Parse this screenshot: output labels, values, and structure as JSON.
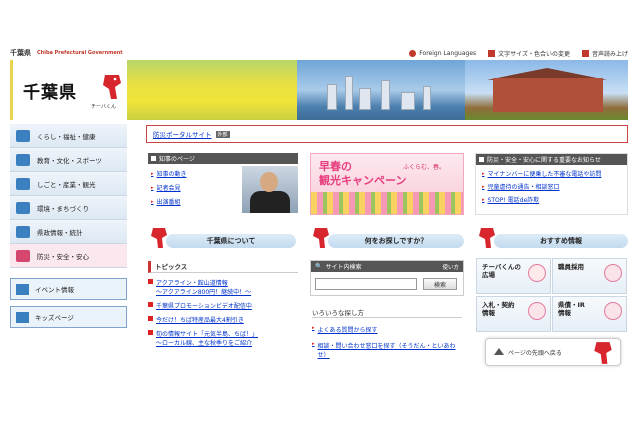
{
  "header": {
    "brand": "千葉県",
    "brand_en": "Chiba Prefectural Government",
    "utilities": [
      {
        "label": "Foreign Languages",
        "icon": "globe-icon"
      },
      {
        "label": "文字サイズ・色合いの変更",
        "icon": "text-size-icon"
      },
      {
        "label": "音声読み上げ",
        "icon": "speaker-icon"
      }
    ]
  },
  "logo": {
    "kanji": "千葉県",
    "kana": "チーバくん"
  },
  "bousai": {
    "link": "防災ポータルサイト",
    "tag": "外部"
  },
  "leftnav": {
    "items": [
      {
        "label": "くらし・福祉・健康"
      },
      {
        "label": "教育・文化・スポーツ"
      },
      {
        "label": "しごと・産業・観光"
      },
      {
        "label": "環境・まちづくり"
      },
      {
        "label": "県政情報・統計"
      },
      {
        "label": "防災・安全・安心"
      }
    ],
    "buttons": [
      {
        "label": "イベント情報"
      },
      {
        "label": "キッズページ"
      }
    ]
  },
  "governor": {
    "heading": "知事のページ",
    "links": [
      "知事の動き",
      "記者会見",
      "出演番組"
    ]
  },
  "campaign": {
    "line1": "早春の",
    "line2": "観光キャンペーン",
    "line3": "ふくらむ、春。"
  },
  "safety": {
    "heading": "防災・安全・安心に関する重要なお知らせ",
    "links": [
      "マイナンバーに便乗した不審な電話や訪問",
      "児童虐待の通告・相談窓口",
      "STOP! 電話de詐欺"
    ]
  },
  "sections": {
    "about": "千葉県について",
    "search_what": "何をお探しですか？",
    "recommended": "おすすめ情報"
  },
  "topics": {
    "heading": "トピックス",
    "items": [
      {
        "line1": "アクアライン・館山道情報",
        "line2": "～アクアライン800円！継続中！～"
      },
      {
        "line1": "千葉県プロモーションビデオ配信中",
        "line2": ""
      },
      {
        "line1": "今だけ！ちば特産品最大4割引き",
        "line2": ""
      },
      {
        "line1": "旬の情報サイト「元気半島、ちば！」",
        "line2": "～ローカル線、主な秋季りをご紹介"
      }
    ]
  },
  "site_search": {
    "heading": "サイト内検索",
    "howto": "使い方",
    "placeholder": "",
    "button": "検索"
  },
  "howto": {
    "heading": "いろいろな探し方",
    "links": [
      "よくある質問から探す",
      "相談・問い合わせ窓口を探す（そうだん・といあわせ）"
    ]
  },
  "recommended": [
    {
      "line1": "チーバくんの広場",
      "line2": ""
    },
    {
      "line1": "職員採用",
      "line2": ""
    },
    {
      "line1": "入札・契約",
      "line2": "情報"
    },
    {
      "line1": "県債・IR",
      "line2": "情報"
    }
  ],
  "totop": {
    "label": "ページの先頭へ戻る"
  },
  "colors": {
    "accent": "#c0392b",
    "link": "#0033cc",
    "nav_bg": "#dde8f3",
    "pink": "#e73c7e"
  }
}
